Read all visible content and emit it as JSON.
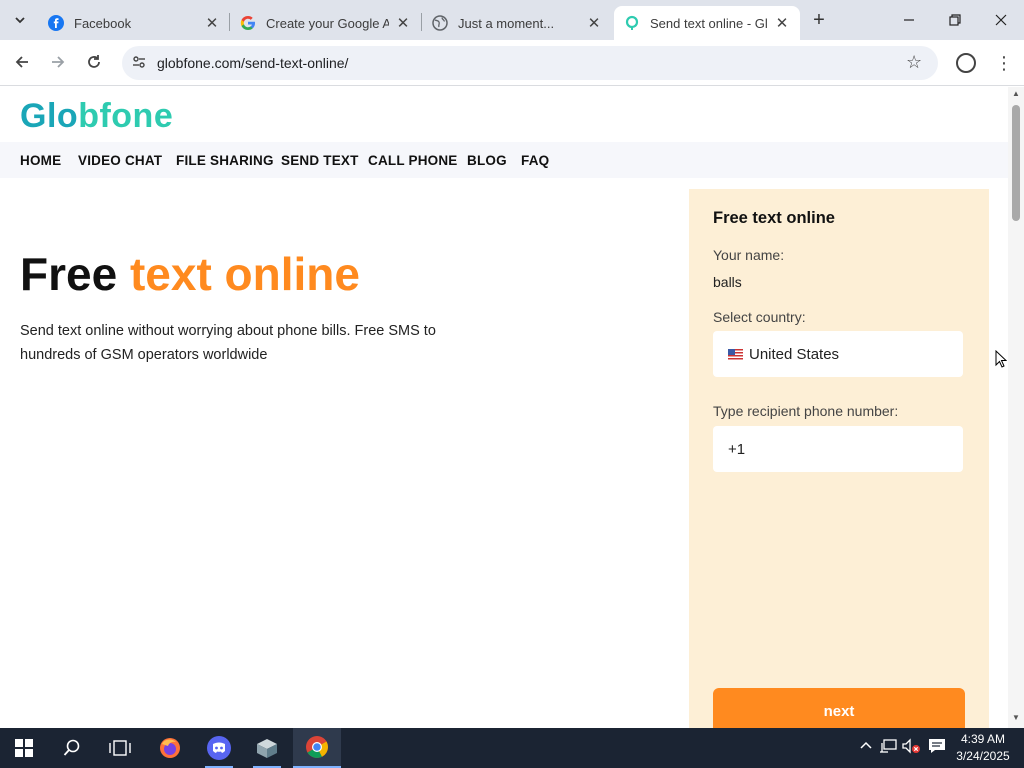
{
  "browser": {
    "tabs": [
      {
        "title": "Facebook",
        "icon": "facebook-icon"
      },
      {
        "title": "Create your Google Ac",
        "icon": "google-icon"
      },
      {
        "title": "Just a moment...",
        "icon": "globe-icon"
      },
      {
        "title": "Send text online - Glol",
        "icon": "globfone-icon"
      }
    ],
    "address": "globfone.com/send-text-online/"
  },
  "site": {
    "logo": {
      "part1": "Gl",
      "part2": "o",
      "part3": "bfone"
    },
    "nav": [
      "HOME",
      "VIDEO CHAT",
      "FILE SHARING",
      "SEND TEXT",
      "CALL PHONE",
      "BLOG",
      "FAQ"
    ],
    "hero": {
      "word1": "Free ",
      "accent": "text online"
    },
    "description": "Send text online without worrying about phone bills. Free SMS to hundreds of GSM operators worldwide"
  },
  "panel": {
    "title": "Free text online",
    "name_label": "Your name:",
    "name_value": "balls",
    "country_label": "Select country:",
    "country_value": "United States",
    "phone_label": "Type recipient phone number:",
    "phone_value": "+1",
    "next_label": "next"
  },
  "taskbar": {
    "time": "4:39 AM",
    "date": "3/24/2025"
  },
  "colors": {
    "accent": "#ff8a1f",
    "panel_bg": "#fdefd6",
    "logo_teal": "#1aa6b7"
  }
}
